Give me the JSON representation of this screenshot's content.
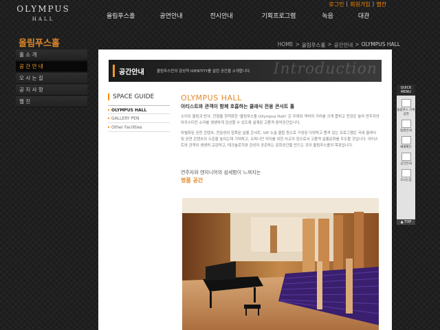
{
  "header": {
    "logo_line1": "OLYMPUS",
    "logo_line2": "HALL",
    "util": [
      "로그인",
      "회원가입",
      "맵전"
    ],
    "nav": [
      "올림푸스홀",
      "공연안내",
      "전시안내",
      "기획프로그램",
      "녹음",
      "대관"
    ]
  },
  "section_title": "올림푸스홀",
  "breadcrumb": [
    "HOME",
    "올림푸스홀",
    "공간안내",
    "OLYMPUS HALL"
  ],
  "lnb": [
    {
      "label": "홀 소 개",
      "active": false
    },
    {
      "label": "공 간 안 내",
      "active": true
    },
    {
      "label": "오 시 는 길",
      "active": false
    },
    {
      "label": "공 지 사 항",
      "active": false
    },
    {
      "label": "웹 진",
      "active": false
    }
  ],
  "banner": {
    "title": "공간안내",
    "desc": "올림푸스만의 감성적 IDENTITY를 살린 공간을 소개합니다.",
    "watermark": "Introduction"
  },
  "space_guide": {
    "heading": "SPACE GUIDE",
    "items": [
      "OLYMPUS HALL",
      "GALLERY PEN",
      "Other Facilities"
    ]
  },
  "content": {
    "title": "OLYMPUS HALL",
    "subtitle": "아티스트와 관객이 함께 호흡하는 클래식 전용 콘서트 홀",
    "para1": "소리의 울림과 반사, 잔향을 최적화한 '올림푸스홀 (Olympus Hall)' 은 무대와 객석의 거리를 크게 좁히고 천장은 높여 연주자의 아우스티칸 소리를 생생하게 감상할 수 있도록 설계된 고품격 음악공간입니다.",
    "para2": "차별화된 공연 콘텐츠, 전문성이 접목된 살롱 콘서트, VIP 소설 클럽 등으로 구성된 다양하고 품격 있는 프로그램은 국내 클래식 및 공연 콘텐츠의 수준을 높이는데 기여하고, 오피니언 리더를 위한 사교의 장으로서 고품격 살롱문화를 주도할 것입니다. 아티스트와 관객이 생생히 교감하고, 테크놀로지와 감성이 공존하는 문화공간을 만드는 것이 올림푸스홀의 목표입니다.",
    "quote1": "연주자와 엔지니어의 섬세함이 느껴지는",
    "quote2": "명품 공간"
  },
  "quick_menu": {
    "heading": "QUICK MENU",
    "items": [
      "올림푸스 기획공연",
      "팀원안내",
      "예매확인",
      "공간안내",
      "오시는길"
    ],
    "top": "TOP"
  }
}
